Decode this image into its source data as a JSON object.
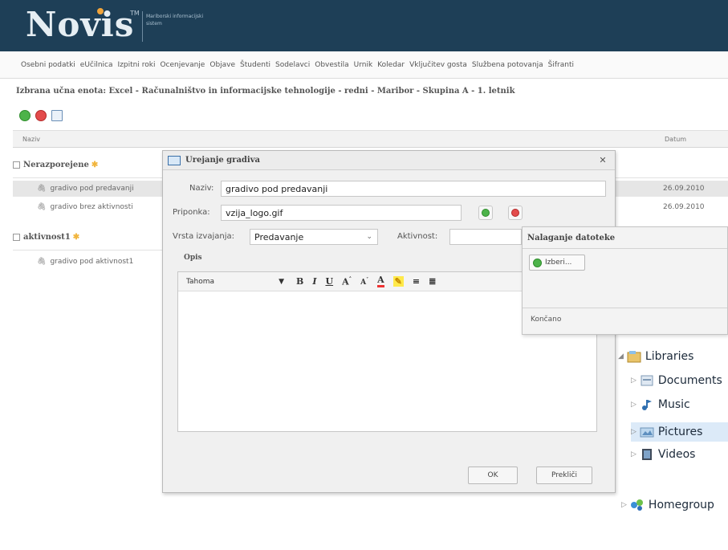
{
  "header": {
    "logo": "Novis",
    "tm": "TM",
    "subtitle": "Mariborski informacijski sistem"
  },
  "menu": {
    "items": [
      "Osebni podatki",
      "eUčilnica",
      "Izpitni roki",
      "Ocenjevanje",
      "Objave",
      "Študenti",
      "Sodelavci",
      "Obvestila",
      "Urnik",
      "Koledar",
      "Vključitev gosta",
      "Službena potovanja",
      "Šifranti"
    ]
  },
  "selected_unit": "Izbrana učna enota: Excel - Računalništvo in informacijske tehnologije - redni - Maribor - Skupina A - 1. letnik",
  "table": {
    "col_naziv": "Naziv",
    "col_datum": "Datum",
    "groups": [
      {
        "name": "Nerazporejene",
        "rows": [
          {
            "name": "gradivo pod predavanji",
            "date": "26.09.2010"
          },
          {
            "name": "gradivo brez aktivnosti",
            "date": "26.09.2010"
          }
        ]
      },
      {
        "name": "aktivnost1",
        "rows": [
          {
            "name": "gradivo pod aktivnost1",
            "date": ""
          }
        ]
      }
    ]
  },
  "explorer": {
    "items": [
      "Libraries",
      "Documents",
      "Music",
      "Pictures",
      "Videos",
      "Homegroup"
    ]
  },
  "dialog": {
    "title": "Urejanje gradiva",
    "naziv_label": "Naziv:",
    "naziv_value": "gradivo pod predavanji",
    "priponka_label": "Priponka:",
    "priponka_value": "vzija_logo.gif",
    "vrsta_label": "Vrsta izvajanja:",
    "vrsta_value": "Predavanje",
    "aktivnost_label": "Aktivnost:",
    "aktivnost_value": "",
    "opis_label": "Opis",
    "font": "Tahoma",
    "ok": "OK",
    "cancel": "Prekliči"
  },
  "popup": {
    "title": "Nalaganje datoteke",
    "izberi": "Izberi...",
    "status": "Končano"
  },
  "colors": {
    "header_bg": "#1e3f57",
    "accent_orange": "#f0a43a",
    "green": "#4db34a",
    "red": "#e34b4b"
  }
}
